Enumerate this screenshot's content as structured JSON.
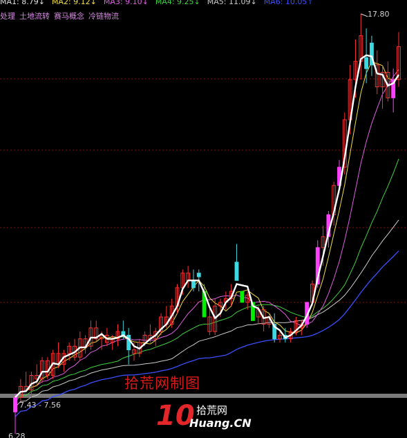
{
  "ma_legend": [
    {
      "label": "MA1: 8.79",
      "arrow": "↓",
      "color": "#e0e0e0"
    },
    {
      "label": "MA2: 9.12",
      "arrow": "↓",
      "color": "#f4e040"
    },
    {
      "label": "MA3: 9.10",
      "arrow": "↓",
      "color": "#e060e0"
    },
    {
      "label": "MA4: 9.25",
      "arrow": "↓",
      "color": "#40d040"
    },
    {
      "label": "MA5: 11.09",
      "arrow": "↓",
      "color": "#cccccc"
    },
    {
      "label": "MA6: 10.05",
      "arrow": "↑",
      "color": "#3a50ff"
    }
  ],
  "concepts": [
    "处理",
    "土地流转",
    "赛马概念",
    "冷链物流"
  ],
  "labels": {
    "high": "17.80",
    "mid": "7.43 - 7.56",
    "low": "6.28"
  },
  "watermark": "拾荒网制图",
  "logo": {
    "big": "10",
    "cn": "拾荒网",
    "domain": "Huang.CN"
  },
  "colors": {
    "up": "#ff3030",
    "down": "#40d8e0",
    "limit_up": "#ff40ff",
    "limit_down": "#00ee00",
    "grid": "#8a1010"
  },
  "chart_data": {
    "type": "candlestick",
    "y_range_approx": [
      6.28,
      17.8
    ],
    "candles": [
      {
        "o": 6.9,
        "h": 7.4,
        "l": 6.3,
        "c": 7.3,
        "k": "m"
      },
      {
        "o": 7.3,
        "h": 7.8,
        "l": 7.2,
        "c": 7.6,
        "k": "u"
      },
      {
        "o": 7.6,
        "h": 8.0,
        "l": 7.5,
        "c": 7.5,
        "k": "u"
      },
      {
        "o": 7.5,
        "h": 8.0,
        "l": 7.3,
        "c": 7.9,
        "k": "u"
      },
      {
        "o": 7.9,
        "h": 8.2,
        "l": 7.6,
        "c": 7.8,
        "k": "u"
      },
      {
        "o": 7.8,
        "h": 8.4,
        "l": 7.7,
        "c": 8.3,
        "k": "u"
      },
      {
        "o": 8.3,
        "h": 8.4,
        "l": 7.8,
        "c": 7.9,
        "k": "u"
      },
      {
        "o": 7.9,
        "h": 8.6,
        "l": 7.8,
        "c": 8.5,
        "k": "u"
      },
      {
        "o": 8.5,
        "h": 8.8,
        "l": 8.1,
        "c": 8.2,
        "k": "u"
      },
      {
        "o": 8.2,
        "h": 8.6,
        "l": 8.0,
        "c": 8.5,
        "k": "u"
      },
      {
        "o": 8.5,
        "h": 8.8,
        "l": 8.3,
        "c": 8.7,
        "k": "u"
      },
      {
        "o": 8.7,
        "h": 8.9,
        "l": 8.3,
        "c": 8.4,
        "k": "u"
      },
      {
        "o": 8.4,
        "h": 9.1,
        "l": 8.3,
        "c": 8.9,
        "k": "u"
      },
      {
        "o": 8.9,
        "h": 9.0,
        "l": 8.5,
        "c": 8.7,
        "k": "u"
      },
      {
        "o": 8.7,
        "h": 9.4,
        "l": 8.6,
        "c": 9.2,
        "k": "u"
      },
      {
        "o": 9.2,
        "h": 9.4,
        "l": 8.8,
        "c": 8.9,
        "k": "u"
      },
      {
        "o": 8.9,
        "h": 9.1,
        "l": 8.6,
        "c": 9.0,
        "k": "u"
      },
      {
        "o": 9.0,
        "h": 9.2,
        "l": 8.7,
        "c": 8.8,
        "k": "u"
      },
      {
        "o": 8.8,
        "h": 9.0,
        "l": 8.6,
        "c": 8.9,
        "k": "u"
      },
      {
        "o": 8.9,
        "h": 9.3,
        "l": 8.7,
        "c": 9.1,
        "k": "u"
      },
      {
        "o": 9.1,
        "h": 9.4,
        "l": 8.9,
        "c": 9.0,
        "k": "d"
      },
      {
        "o": 9.0,
        "h": 9.2,
        "l": 8.2,
        "c": 8.6,
        "k": "d"
      },
      {
        "o": 8.6,
        "h": 8.8,
        "l": 8.3,
        "c": 8.5,
        "k": "u"
      },
      {
        "o": 8.5,
        "h": 8.9,
        "l": 8.4,
        "c": 8.8,
        "k": "u"
      },
      {
        "o": 8.8,
        "h": 9.1,
        "l": 8.7,
        "c": 9.0,
        "k": "u"
      },
      {
        "o": 9.0,
        "h": 9.3,
        "l": 8.8,
        "c": 8.9,
        "k": "u"
      },
      {
        "o": 8.9,
        "h": 9.2,
        "l": 8.7,
        "c": 9.1,
        "k": "u"
      },
      {
        "o": 9.1,
        "h": 9.6,
        "l": 9.0,
        "c": 9.5,
        "k": "u"
      },
      {
        "o": 9.5,
        "h": 9.8,
        "l": 9.2,
        "c": 9.3,
        "k": "u"
      },
      {
        "o": 9.3,
        "h": 10.0,
        "l": 9.2,
        "c": 9.8,
        "k": "u"
      },
      {
        "o": 9.8,
        "h": 10.4,
        "l": 9.6,
        "c": 10.3,
        "k": "u"
      },
      {
        "o": 10.3,
        "h": 10.8,
        "l": 10.1,
        "c": 10.7,
        "k": "u"
      },
      {
        "o": 10.7,
        "h": 10.9,
        "l": 10.3,
        "c": 10.5,
        "k": "u"
      },
      {
        "o": 10.5,
        "h": 10.8,
        "l": 10.2,
        "c": 10.3,
        "k": "d"
      },
      {
        "o": 10.6,
        "h": 10.8,
        "l": 10.2,
        "c": 10.7,
        "k": "d"
      },
      {
        "o": 10.2,
        "h": 10.4,
        "l": 9.5,
        "c": 9.5,
        "k": "l"
      },
      {
        "o": 9.5,
        "h": 9.8,
        "l": 9.0,
        "c": 9.1,
        "k": "u"
      },
      {
        "o": 9.1,
        "h": 10.0,
        "l": 9.0,
        "c": 9.8,
        "k": "u"
      },
      {
        "o": 9.8,
        "h": 10.0,
        "l": 9.5,
        "c": 9.9,
        "k": "u"
      },
      {
        "o": 9.9,
        "h": 10.2,
        "l": 9.7,
        "c": 10.0,
        "k": "u"
      },
      {
        "o": 10.0,
        "h": 10.4,
        "l": 9.8,
        "c": 10.2,
        "k": "u"
      },
      {
        "o": 10.5,
        "h": 11.5,
        "l": 10.5,
        "c": 11.0,
        "k": "d"
      },
      {
        "o": 10.2,
        "h": 10.2,
        "l": 9.9,
        "c": 9.9,
        "k": "l"
      },
      {
        "o": 9.9,
        "h": 10.2,
        "l": 9.7,
        "c": 10.1,
        "k": "u"
      },
      {
        "o": 9.9,
        "h": 9.9,
        "l": 9.4,
        "c": 9.4,
        "k": "l"
      },
      {
        "o": 9.5,
        "h": 9.8,
        "l": 9.3,
        "c": 9.7,
        "k": "u"
      },
      {
        "o": 9.7,
        "h": 9.8,
        "l": 9.1,
        "c": 9.3,
        "k": "u"
      },
      {
        "o": 9.3,
        "h": 9.6,
        "l": 9.2,
        "c": 9.5,
        "k": "u"
      },
      {
        "o": 9.3,
        "h": 9.6,
        "l": 8.8,
        "c": 8.9,
        "k": "d"
      },
      {
        "o": 8.9,
        "h": 9.1,
        "l": 8.8,
        "c": 9.0,
        "k": "u"
      },
      {
        "o": 9.0,
        "h": 9.2,
        "l": 8.8,
        "c": 8.9,
        "k": "d"
      },
      {
        "o": 8.9,
        "h": 9.2,
        "l": 8.8,
        "c": 9.1,
        "k": "u"
      },
      {
        "o": 9.1,
        "h": 9.5,
        "l": 9.0,
        "c": 9.4,
        "k": "u"
      },
      {
        "o": 9.2,
        "h": 9.4,
        "l": 9.0,
        "c": 9.3,
        "k": "u"
      },
      {
        "o": 9.3,
        "h": 9.9,
        "l": 9.2,
        "c": 9.9,
        "k": "m"
      },
      {
        "o": 9.9,
        "h": 10.5,
        "l": 9.8,
        "c": 10.4,
        "k": "u"
      },
      {
        "o": 10.4,
        "h": 11.6,
        "l": 10.3,
        "c": 11.4,
        "k": "m"
      },
      {
        "o": 11.4,
        "h": 12.0,
        "l": 10.9,
        "c": 11.7,
        "k": "u"
      },
      {
        "o": 11.7,
        "h": 12.4,
        "l": 11.4,
        "c": 12.3,
        "k": "m"
      },
      {
        "o": 12.3,
        "h": 13.2,
        "l": 12.0,
        "c": 13.1,
        "k": "u"
      },
      {
        "o": 13.1,
        "h": 13.8,
        "l": 12.9,
        "c": 13.6,
        "k": "m"
      },
      {
        "o": 13.6,
        "h": 15.1,
        "l": 13.4,
        "c": 14.9,
        "k": "u"
      },
      {
        "o": 14.9,
        "h": 16.4,
        "l": 14.5,
        "c": 16.0,
        "k": "u"
      },
      {
        "o": 16.0,
        "h": 17.1,
        "l": 15.5,
        "c": 16.5,
        "k": "u"
      },
      {
        "o": 16.5,
        "h": 17.8,
        "l": 16.0,
        "c": 17.2,
        "k": "u"
      },
      {
        "o": 16.6,
        "h": 17.4,
        "l": 15.9,
        "c": 16.3,
        "k": "d"
      },
      {
        "o": 17.0,
        "h": 17.2,
        "l": 16.1,
        "c": 16.4,
        "k": "d"
      },
      {
        "o": 16.4,
        "h": 16.8,
        "l": 15.6,
        "c": 15.8,
        "k": "u"
      },
      {
        "o": 15.8,
        "h": 16.4,
        "l": 15.2,
        "c": 16.2,
        "k": "u"
      },
      {
        "o": 16.2,
        "h": 16.5,
        "l": 15.4,
        "c": 15.5,
        "k": "u"
      },
      {
        "o": 15.5,
        "h": 16.3,
        "l": 15.1,
        "c": 16.0,
        "k": "m"
      },
      {
        "o": 16.0,
        "h": 17.3,
        "l": 15.8,
        "c": 16.9,
        "k": "u"
      }
    ]
  }
}
